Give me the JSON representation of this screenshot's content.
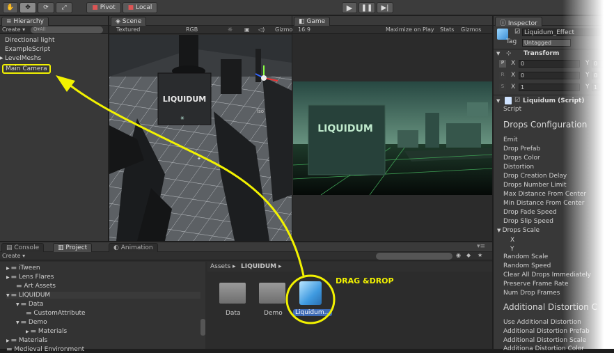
{
  "toolbar": {
    "pivot_label": "Pivot",
    "local_label": "Local",
    "tool_icons": [
      "hand-icon",
      "move-icon",
      "rotate-icon",
      "scale-icon"
    ],
    "play_icons": [
      "play-icon",
      "pause-icon",
      "step-icon"
    ]
  },
  "hierarchy": {
    "tab": "Hierarchy",
    "create_label": "Create ▾",
    "search_placeholder": "Q▾All",
    "items": [
      "Directional light",
      "ExampleScript",
      "LevelMeshs",
      "Main Camera"
    ]
  },
  "scene": {
    "tab": "Scene",
    "mode": "Textured",
    "channel": "RGB",
    "gizmos": "Gizmo",
    "logo_text": "LIQUIDUM",
    "persp_label": "Iso"
  },
  "game": {
    "tab": "Game",
    "aspect": "16:9",
    "maximize": "Maximize on Play",
    "stats": "Stats",
    "gizmos": "Gizmos",
    "logo_text": "LIQUIDUM"
  },
  "inspector": {
    "tab": "Inspector",
    "object_name": "Liquidum_Effect",
    "tag_label": "Tag",
    "tag_value": "Untagged",
    "transform": {
      "title": "Transform",
      "rows": [
        {
          "key": "P",
          "axis": "X",
          "value": "0",
          "y": "0"
        },
        {
          "key": "R",
          "axis": "X",
          "value": "0",
          "y": "0"
        },
        {
          "key": "S",
          "axis": "X",
          "value": "1",
          "y": "1"
        }
      ]
    },
    "script_component": "Liquidum (Script)",
    "script_label": "Script",
    "drops_config_title": "Drops Configuration",
    "fields": [
      "Emit",
      "Drop Prefab",
      "Drops Color",
      "Distortion",
      "Drop Creation Delay",
      "Drops Number Limit",
      "Max Distance From Center",
      "Min Distance From Center",
      "Drop Fade Speed",
      "Drop Slip Speed",
      "Drops Scale",
      "X",
      "Y",
      "Random Scale",
      "Random Speed",
      "Clear All Drops Immediately",
      "Preserve Frame Rate",
      "Num Drop Frames"
    ],
    "additional_title": "Additional Distortion C",
    "additional_fields": [
      "Use Additional Distortion",
      "Additional Distortion Prefab",
      "Additional Distortion Scale",
      "Additiona Distortion Color"
    ]
  },
  "bottom": {
    "tabs": [
      "Console",
      "Project",
      "Animation"
    ],
    "create_label": "Create ▾",
    "tree": [
      {
        "label": "iTween",
        "indent": 0
      },
      {
        "label": "Lens Flares",
        "indent": 0
      },
      {
        "label": "Art Assets",
        "indent": 1
      },
      {
        "label": "LIQUIDUM",
        "indent": 0
      },
      {
        "label": "Data",
        "indent": 1
      },
      {
        "label": "CustomAttribute",
        "indent": 2
      },
      {
        "label": "Demo",
        "indent": 1
      },
      {
        "label": "Materials",
        "indent": 2
      },
      {
        "label": "Materials",
        "indent": 0
      },
      {
        "label": "Medieval Environment",
        "indent": 0
      }
    ],
    "breadcrumb_root": "Assets",
    "breadcrumb_sep": "▸",
    "breadcrumb_current": "LIQUIDUM",
    "assets": [
      "Data",
      "Demo",
      "Liquidum..."
    ]
  },
  "annotation": {
    "drag_label": "DRAG &DROP",
    "color": "#f2f200"
  }
}
